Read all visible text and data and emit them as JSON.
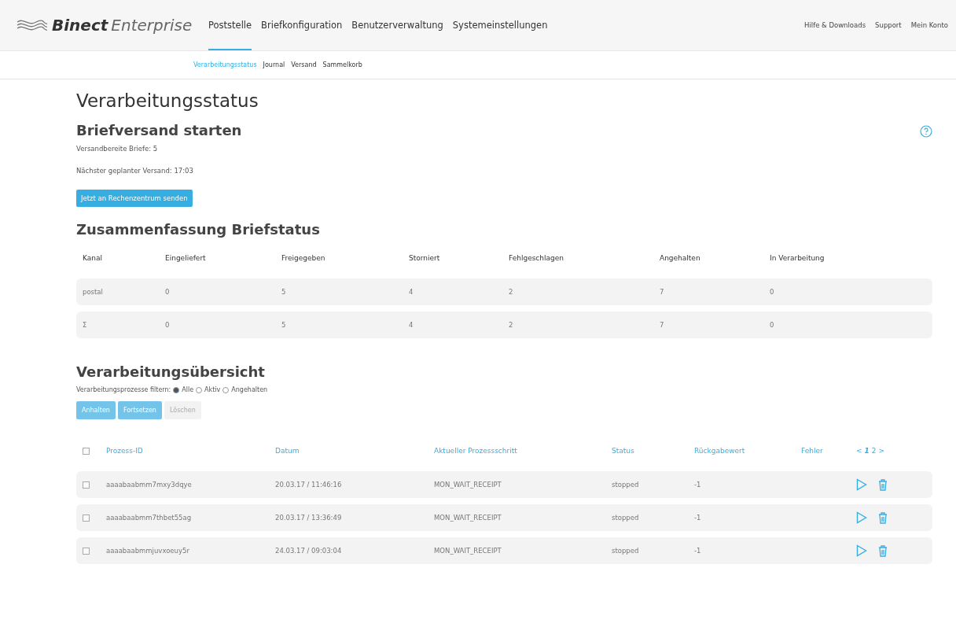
{
  "header": {
    "logo": {
      "brand": "Binect",
      "product": "Enterprise"
    },
    "nav": [
      {
        "label": "Poststelle",
        "selected": true
      },
      {
        "label": "Briefkonfiguration",
        "selected": false
      },
      {
        "label": "Benutzerverwaltung",
        "selected": false
      },
      {
        "label": "Systemeinstellungen",
        "selected": false
      }
    ],
    "links": [
      "Hilfe & Downloads",
      "Support",
      "Mein Konto"
    ]
  },
  "subnav": [
    {
      "label": "Verarbeitungsstatus",
      "selected": true
    },
    {
      "label": "Journal",
      "selected": false
    },
    {
      "label": "Versand",
      "selected": false
    },
    {
      "label": "Sammelkorb",
      "selected": false
    }
  ],
  "page_title": "Verarbeitungsstatus",
  "dispatch": {
    "title": "Briefversand starten",
    "ready": "Versandbereite Briefe: 5",
    "next": "Nächster geplanter Versand: 17:03",
    "button": "Jetzt an Rechenzentrum senden"
  },
  "summary": {
    "title": "Zusammenfassung Briefstatus",
    "columns": [
      "Kanal",
      "Eingeliefert",
      "Freigegeben",
      "Storniert",
      "Fehlgeschlagen",
      "Angehalten",
      "In Verarbeitung"
    ],
    "rows": [
      [
        "postal",
        "0",
        "5",
        "4",
        "2",
        "7",
        "0"
      ],
      [
        "Σ",
        "0",
        "5",
        "4",
        "2",
        "7",
        "0"
      ]
    ]
  },
  "overview": {
    "title": "Verarbeitungsübersicht",
    "filter_label": "Verarbeitungsprozesse filtern:",
    "filters": [
      {
        "label": "Alle",
        "selected": true
      },
      {
        "label": "Aktiv",
        "selected": false
      },
      {
        "label": "Angehalten",
        "selected": false
      }
    ],
    "buttons": [
      {
        "label": "Anhalten",
        "disabled": false
      },
      {
        "label": "Fortsetzen",
        "disabled": false
      },
      {
        "label": "Löschen",
        "disabled": true
      }
    ],
    "select_all": {
      "checked": false
    },
    "columns": [
      "Prozess-ID",
      "Datum",
      "Aktueller Prozessschritt",
      "Status",
      "Rückgabewert",
      "Fehler"
    ],
    "pagination": {
      "prev": "<",
      "pages": [
        {
          "label": "1",
          "selected": true
        },
        {
          "label": "2",
          "selected": false
        }
      ],
      "next": ">"
    },
    "rows": [
      {
        "checked": false,
        "cells": [
          "aaaabaabmm7mxy3dqye",
          "20.03.17 / 11:46:16",
          "MON_WAIT_RECEIPT",
          "stopped",
          "-1"
        ]
      },
      {
        "checked": false,
        "cells": [
          "aaaabaabmm7thbet55ag",
          "20.03.17 / 13:36:49",
          "MON_WAIT_RECEIPT",
          "stopped",
          "-1"
        ]
      },
      {
        "checked": false,
        "cells": [
          "aaaabaabmmjuvxoeuy5r",
          "24.03.17 / 09:03:04",
          "MON_WAIT_RECEIPT",
          "stopped",
          "-1"
        ]
      }
    ]
  }
}
